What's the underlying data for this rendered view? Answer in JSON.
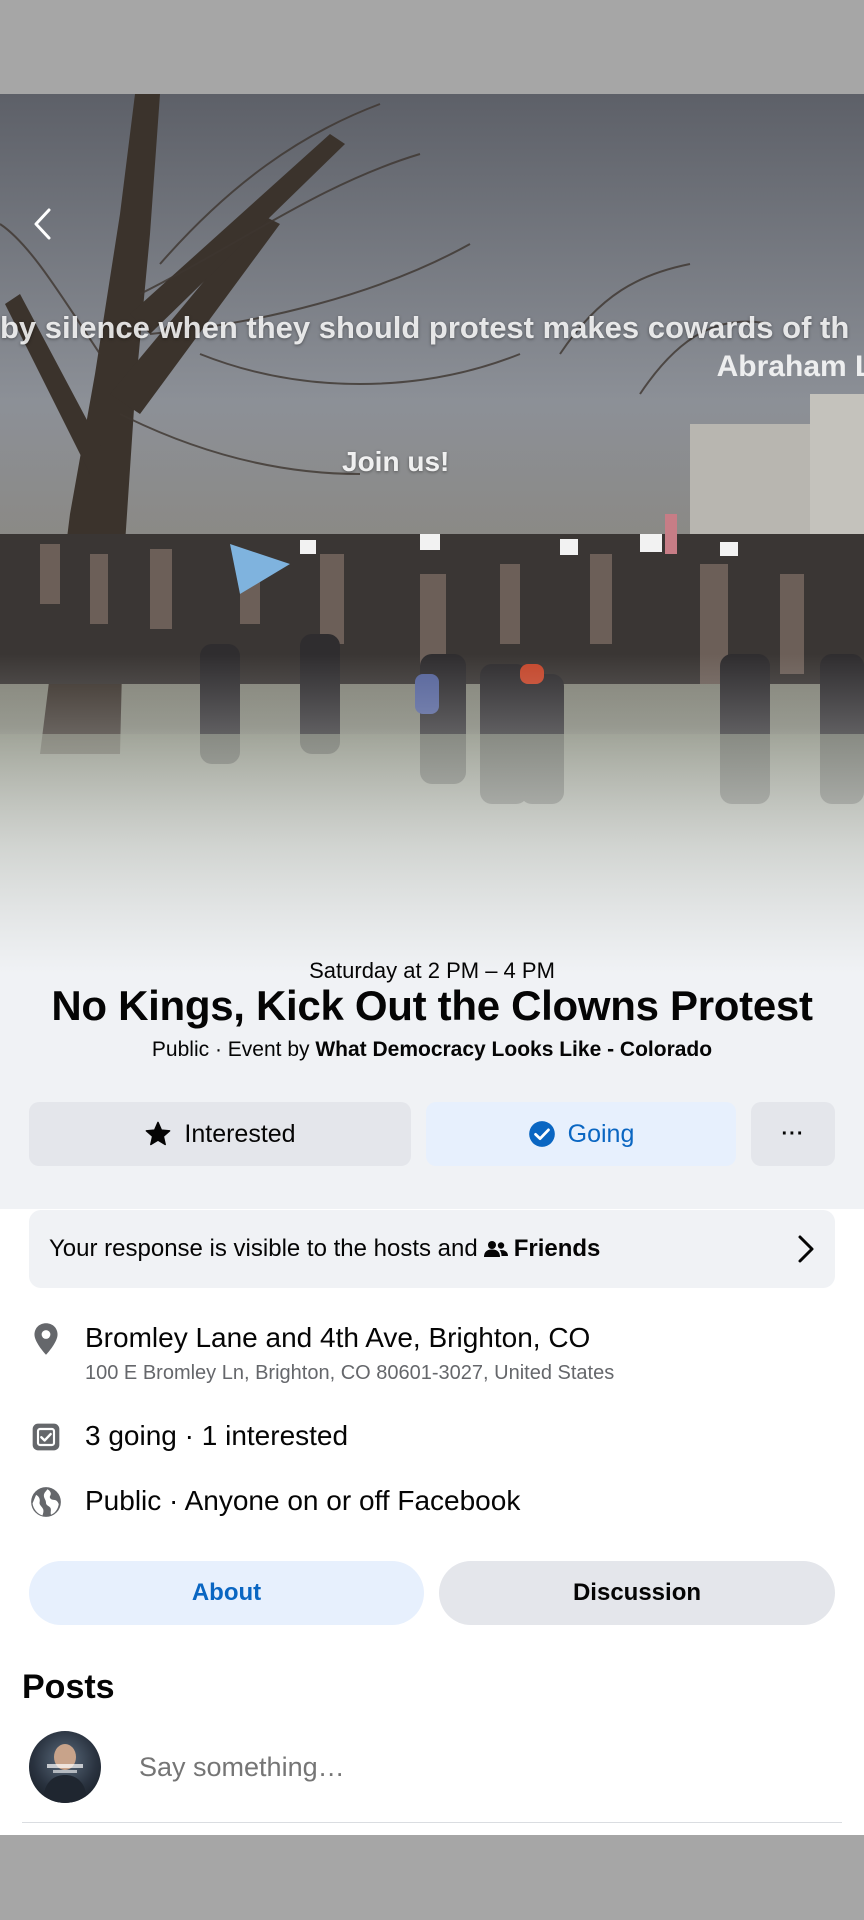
{
  "cover": {
    "overlay_quote": "by silence when they should protest makes cowards of th",
    "overlay_quote_author": "Abraham Lin",
    "overlay_join": "Join us!"
  },
  "event": {
    "date_time": "Saturday at 2 PM – 4 PM",
    "title": "No Kings, Kick Out the Clowns Protest",
    "meta_prefix": "Public · Event by ",
    "host": "What Democracy Looks Like - Colorado"
  },
  "actions": {
    "interested_label": "Interested",
    "going_label": "Going",
    "more_label": "···"
  },
  "response_notice": {
    "text": "Your response is visible to the hosts and",
    "audience": "Friends"
  },
  "details": {
    "location_name": "Bromley Lane and 4th Ave, Brighton, CO",
    "location_address": "100 E Bromley Ln, Brighton, CO 80601-3027, United States",
    "attendance": "3 going · 1 interested",
    "privacy": "Public · Anyone on or off Facebook"
  },
  "tabs": [
    {
      "label": "About",
      "active": true
    },
    {
      "label": "Discussion",
      "active": false
    }
  ],
  "posts": {
    "title": "Posts",
    "composer_placeholder": "Say something…"
  },
  "colors": {
    "accent": "#0a66c2",
    "accent_bg": "#e7f0fd",
    "button_gray": "#e4e6eb",
    "secondary_text": "#65676b"
  }
}
